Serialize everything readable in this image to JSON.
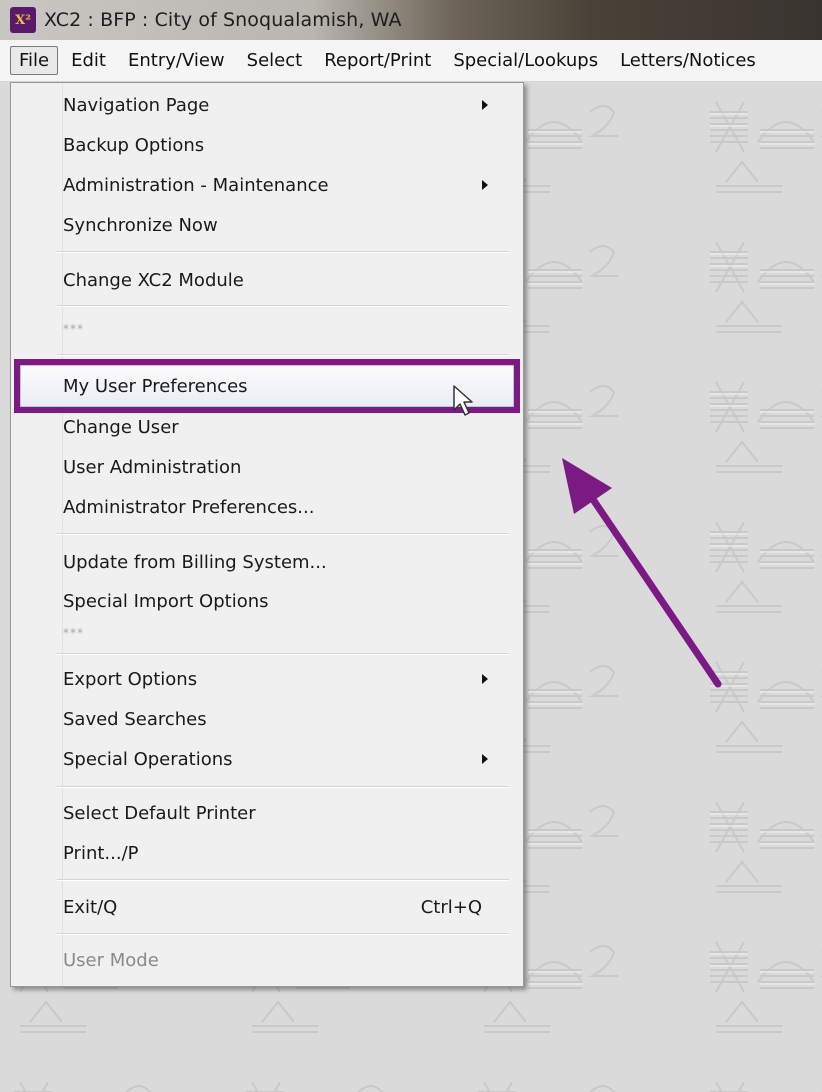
{
  "window": {
    "title": "XC2 : BFP : City of Snoqualamish, WA",
    "logo_text": "X²"
  },
  "menubar": {
    "items": [
      {
        "label": "File",
        "active": true
      },
      {
        "label": "Edit"
      },
      {
        "label": "Entry/View"
      },
      {
        "label": "Select"
      },
      {
        "label": "Report/Print"
      },
      {
        "label": "Special/Lookups"
      },
      {
        "label": "Letters/Notices"
      }
    ]
  },
  "file_menu": {
    "items": [
      {
        "label": "Navigation Page",
        "submenu": true
      },
      {
        "label": "Backup Options"
      },
      {
        "label": "Administration - Maintenance",
        "submenu": true
      },
      {
        "label": "Synchronize Now"
      },
      {
        "label": "Change XC2 Module"
      },
      {
        "label": "***"
      },
      {
        "label": "My User Preferences",
        "highlighted": true
      },
      {
        "label": "Change User"
      },
      {
        "label": "User Administration"
      },
      {
        "label": "Administrator Preferences..."
      },
      {
        "label": "Update from Billing System..."
      },
      {
        "label": "Special Import Options"
      },
      {
        "label": "***"
      },
      {
        "label": "Export Options",
        "submenu": true
      },
      {
        "label": "Saved Searches"
      },
      {
        "label": "Special Operations",
        "submenu": true
      },
      {
        "label": "Select Default Printer"
      },
      {
        "label": "Print.../P"
      },
      {
        "label": "Exit/Q",
        "shortcut": "Ctrl+Q"
      },
      {
        "label": "User Mode",
        "disabled": true
      }
    ]
  },
  "annotation": {
    "highlight_color": "#7a1a82",
    "arrow_color": "#7a1a82"
  }
}
